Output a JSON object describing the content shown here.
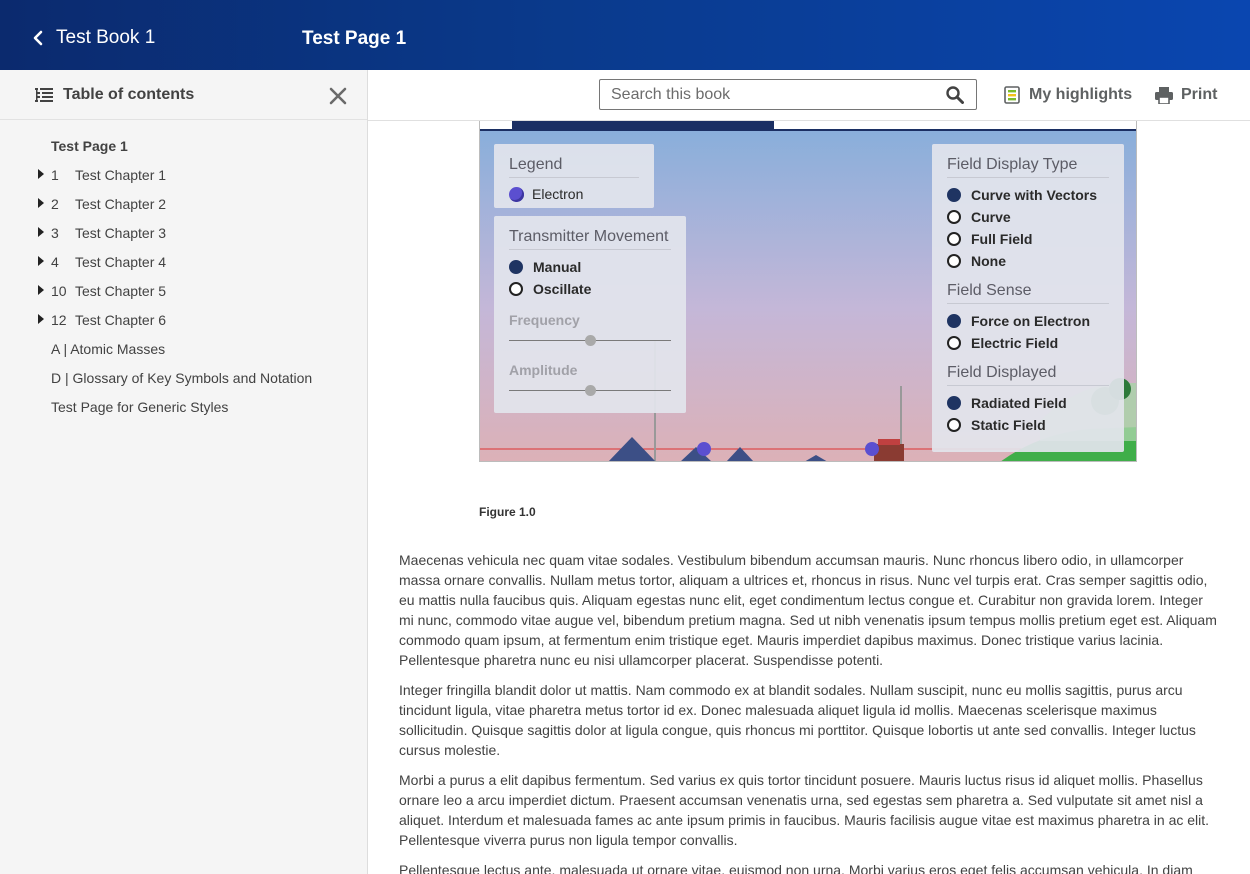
{
  "header": {
    "back_label": "Test Book 1",
    "page_title": "Test Page 1"
  },
  "sidebar": {
    "title": "Table of contents",
    "items": [
      {
        "label": "Test Page 1"
      },
      {
        "number": "1",
        "label": "Test Chapter 1"
      },
      {
        "number": "2",
        "label": "Test Chapter 2"
      },
      {
        "number": "3",
        "label": "Test Chapter 3"
      },
      {
        "number": "4",
        "label": "Test Chapter 4"
      },
      {
        "number": "10",
        "label": "Test Chapter 5"
      },
      {
        "number": "12",
        "label": "Test Chapter 6"
      },
      {
        "label": "A  | Atomic Masses"
      },
      {
        "label": "D  | Glossary of Key Symbols and Notation"
      },
      {
        "label": "Test Page for Generic Styles"
      }
    ]
  },
  "toolbar": {
    "search_placeholder": "Search this book",
    "highlights_label": "My highlights",
    "print_label": "Print"
  },
  "simulation": {
    "legend": {
      "title": "Legend",
      "item": "Electron"
    },
    "transmitter": {
      "title": "Transmitter Movement",
      "options": [
        "Manual",
        "Oscillate"
      ],
      "selected": "Manual",
      "frequency_label": "Frequency",
      "frequency_level": 0.5,
      "amplitude_label": "Amplitude",
      "amplitude_level": 0.5
    },
    "field_display_type": {
      "title": "Field Display Type",
      "options": [
        "Curve with Vectors",
        "Curve",
        "Full Field",
        "None"
      ],
      "selected": "Curve with Vectors"
    },
    "field_sense": {
      "title": "Field Sense",
      "options": [
        "Force on Electron",
        "Electric Field"
      ],
      "selected": "Force on Electron"
    },
    "field_displayed": {
      "title": "Field Displayed",
      "options": [
        "Radiated Field",
        "Static Field"
      ],
      "selected": "Radiated Field"
    }
  },
  "figure_caption": "Figure 1.0",
  "paragraphs": [
    "Maecenas vehicula nec quam vitae sodales. Vestibulum bibendum accumsan mauris. Nunc rhoncus libero odio, in ullamcorper massa ornare convallis. Nullam metus tortor, aliquam a ultrices et, rhoncus in risus. Nunc vel turpis erat. Cras semper sagittis odio, eu mattis nulla faucibus quis. Aliquam egestas nunc elit, eget condimentum lectus congue et. Curabitur non gravida lorem. Integer mi nunc, commodo vitae augue vel, bibendum pretium magna. Sed ut nibh venenatis ipsum tempus mollis pretium eget est. Aliquam commodo quam ipsum, at fermentum enim tristique eget. Mauris imperdiet dapibus maximus. Donec tristique varius lacinia. Pellentesque pharetra nunc eu nisi ullamcorper placerat. Suspendisse potenti.",
    "Integer fringilla blandit dolor ut mattis. Nam commodo ex at blandit sodales. Nullam suscipit, nunc eu mollis sagittis, purus arcu tincidunt ligula, vitae pharetra metus tortor id ex. Donec malesuada aliquet ligula id mollis. Maecenas scelerisque maximus sollicitudin. Quisque sagittis dolor at ligula congue, quis rhoncus mi porttitor. Quisque lobortis ut ante sed convallis. Integer luctus cursus molestie.",
    "Morbi a purus a elit dapibus fermentum. Sed varius ex quis tortor tincidunt posuere. Mauris luctus risus id aliquet mollis. Phasellus ornare leo a arcu imperdiet dictum. Praesent accumsan venenatis urna, sed egestas sem pharetra a. Sed vulputate sit amet nisl a aliquet. Interdum et malesuada fames ac ante ipsum primis in faucibus. Mauris facilisis augue vitae est maximus pharetra in ac elit. Pellentesque viverra purus non ligula tempor convallis.",
    "Pellentesque lectus ante, malesuada ut ornare vitae, euismod non urna. Morbi varius eros eget felis accumsan vehicula. In diam"
  ],
  "colors": {
    "header_bg": "#0a3a8c",
    "radio_selected": "#1f3462",
    "electron": "#5b4fd0"
  }
}
